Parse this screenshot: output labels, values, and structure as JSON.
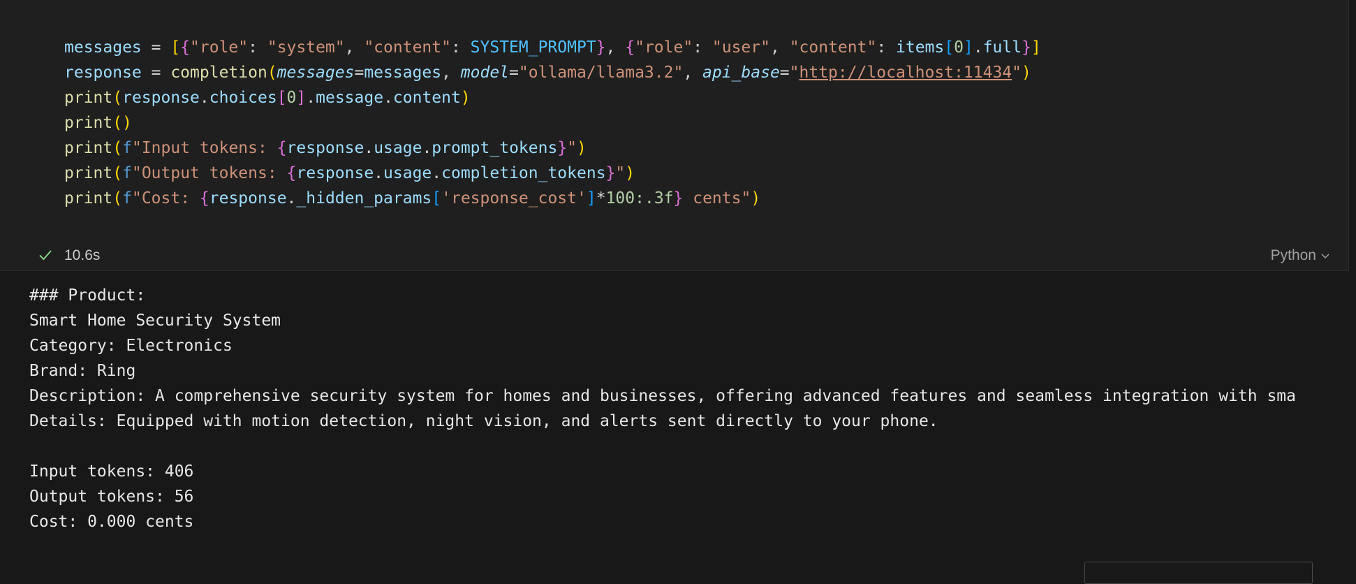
{
  "cell": {
    "code_tokens": [
      [
        {
          "t": "messages",
          "c": "t-var"
        },
        {
          "t": " = ",
          "c": "t-op"
        },
        {
          "t": "[",
          "c": "t-b1"
        },
        {
          "t": "{",
          "c": "t-b2"
        },
        {
          "t": "\"role\"",
          "c": "t-str"
        },
        {
          "t": ": ",
          "c": "t-op"
        },
        {
          "t": "\"system\"",
          "c": "t-str"
        },
        {
          "t": ", ",
          "c": "t-op"
        },
        {
          "t": "\"content\"",
          "c": "t-str"
        },
        {
          "t": ": ",
          "c": "t-op"
        },
        {
          "t": "SYSTEM_PROMPT",
          "c": "t-const"
        },
        {
          "t": "}",
          "c": "t-b2"
        },
        {
          "t": ", ",
          "c": "t-op"
        },
        {
          "t": "{",
          "c": "t-b2"
        },
        {
          "t": "\"role\"",
          "c": "t-str"
        },
        {
          "t": ": ",
          "c": "t-op"
        },
        {
          "t": "\"user\"",
          "c": "t-str"
        },
        {
          "t": ", ",
          "c": "t-op"
        },
        {
          "t": "\"content\"",
          "c": "t-str"
        },
        {
          "t": ": ",
          "c": "t-op"
        },
        {
          "t": "items",
          "c": "t-var"
        },
        {
          "t": "[",
          "c": "t-b3"
        },
        {
          "t": "0",
          "c": "t-num"
        },
        {
          "t": "]",
          "c": "t-b3"
        },
        {
          "t": ".",
          "c": "t-op"
        },
        {
          "t": "full",
          "c": "t-prop"
        },
        {
          "t": "}",
          "c": "t-b2"
        },
        {
          "t": "]",
          "c": "t-b1"
        }
      ],
      [
        {
          "t": "response",
          "c": "t-var"
        },
        {
          "t": " = ",
          "c": "t-op"
        },
        {
          "t": "completion",
          "c": "t-func"
        },
        {
          "t": "(",
          "c": "t-b1"
        },
        {
          "t": "messages",
          "c": "t-param"
        },
        {
          "t": "=",
          "c": "t-op"
        },
        {
          "t": "messages",
          "c": "t-var"
        },
        {
          "t": ", ",
          "c": "t-op"
        },
        {
          "t": "model",
          "c": "t-param"
        },
        {
          "t": "=",
          "c": "t-op"
        },
        {
          "t": "\"ollama/llama3.2\"",
          "c": "t-str"
        },
        {
          "t": ", ",
          "c": "t-op"
        },
        {
          "t": "api_base",
          "c": "t-param"
        },
        {
          "t": "=",
          "c": "t-op"
        },
        {
          "t": "\"",
          "c": "t-str"
        },
        {
          "t": "http://localhost:11434",
          "c": "t-url"
        },
        {
          "t": "\"",
          "c": "t-str"
        },
        {
          "t": ")",
          "c": "t-b1"
        }
      ],
      [
        {
          "t": "print",
          "c": "t-func"
        },
        {
          "t": "(",
          "c": "t-b1"
        },
        {
          "t": "response",
          "c": "t-var"
        },
        {
          "t": ".",
          "c": "t-op"
        },
        {
          "t": "choices",
          "c": "t-prop"
        },
        {
          "t": "[",
          "c": "t-b2"
        },
        {
          "t": "0",
          "c": "t-num"
        },
        {
          "t": "]",
          "c": "t-b2"
        },
        {
          "t": ".",
          "c": "t-op"
        },
        {
          "t": "message",
          "c": "t-prop"
        },
        {
          "t": ".",
          "c": "t-op"
        },
        {
          "t": "content",
          "c": "t-prop"
        },
        {
          "t": ")",
          "c": "t-b1"
        }
      ],
      [
        {
          "t": "print",
          "c": "t-func"
        },
        {
          "t": "()",
          "c": "t-b1"
        }
      ],
      [
        {
          "t": "print",
          "c": "t-func"
        },
        {
          "t": "(",
          "c": "t-b1"
        },
        {
          "t": "f",
          "c": "t-kw"
        },
        {
          "t": "\"Input tokens: ",
          "c": "t-fstr"
        },
        {
          "t": "{",
          "c": "t-b2"
        },
        {
          "t": "response",
          "c": "t-var"
        },
        {
          "t": ".",
          "c": "t-op"
        },
        {
          "t": "usage",
          "c": "t-prop"
        },
        {
          "t": ".",
          "c": "t-op"
        },
        {
          "t": "prompt_tokens",
          "c": "t-prop"
        },
        {
          "t": "}",
          "c": "t-b2"
        },
        {
          "t": "\"",
          "c": "t-fstr"
        },
        {
          "t": ")",
          "c": "t-b1"
        }
      ],
      [
        {
          "t": "print",
          "c": "t-func"
        },
        {
          "t": "(",
          "c": "t-b1"
        },
        {
          "t": "f",
          "c": "t-kw"
        },
        {
          "t": "\"Output tokens: ",
          "c": "t-fstr"
        },
        {
          "t": "{",
          "c": "t-b2"
        },
        {
          "t": "response",
          "c": "t-var"
        },
        {
          "t": ".",
          "c": "t-op"
        },
        {
          "t": "usage",
          "c": "t-prop"
        },
        {
          "t": ".",
          "c": "t-op"
        },
        {
          "t": "completion_tokens",
          "c": "t-prop"
        },
        {
          "t": "}",
          "c": "t-b2"
        },
        {
          "t": "\"",
          "c": "t-fstr"
        },
        {
          "t": ")",
          "c": "t-b1"
        }
      ],
      [
        {
          "t": "print",
          "c": "t-func"
        },
        {
          "t": "(",
          "c": "t-b1"
        },
        {
          "t": "f",
          "c": "t-kw"
        },
        {
          "t": "\"Cost: ",
          "c": "t-fstr"
        },
        {
          "t": "{",
          "c": "t-b2"
        },
        {
          "t": "response",
          "c": "t-var"
        },
        {
          "t": ".",
          "c": "t-op"
        },
        {
          "t": "_hidden_params",
          "c": "t-prop"
        },
        {
          "t": "[",
          "c": "t-b3"
        },
        {
          "t": "'response_cost'",
          "c": "t-str"
        },
        {
          "t": "]",
          "c": "t-b3"
        },
        {
          "t": "*",
          "c": "t-op"
        },
        {
          "t": "100",
          "c": "t-num"
        },
        {
          "t": ":.3f",
          "c": "t-fmt"
        },
        {
          "t": "}",
          "c": "t-b2"
        },
        {
          "t": " cents\"",
          "c": "t-fstr"
        },
        {
          "t": ")",
          "c": "t-b1"
        }
      ]
    ],
    "left_marker": "]",
    "exec_time": "10.6s",
    "language": "Python"
  },
  "icons": {
    "check": "check-icon",
    "chevron": "chevron-down-icon"
  },
  "colors": {
    "check": "#89d185",
    "background": "#181818",
    "cell_background": "#1f1f1f"
  },
  "output": {
    "lines": [
      "### Product:",
      "Smart Home Security System",
      "Category: Electronics",
      "Brand: Ring",
      "Description: A comprehensive security system for homes and businesses, offering advanced features and seamless integration with sma",
      "Details: Equipped with motion detection, night vision, and alerts sent directly to your phone.",
      "",
      "Input tokens: 406",
      "Output tokens: 56",
      "Cost: 0.000 cents"
    ]
  }
}
